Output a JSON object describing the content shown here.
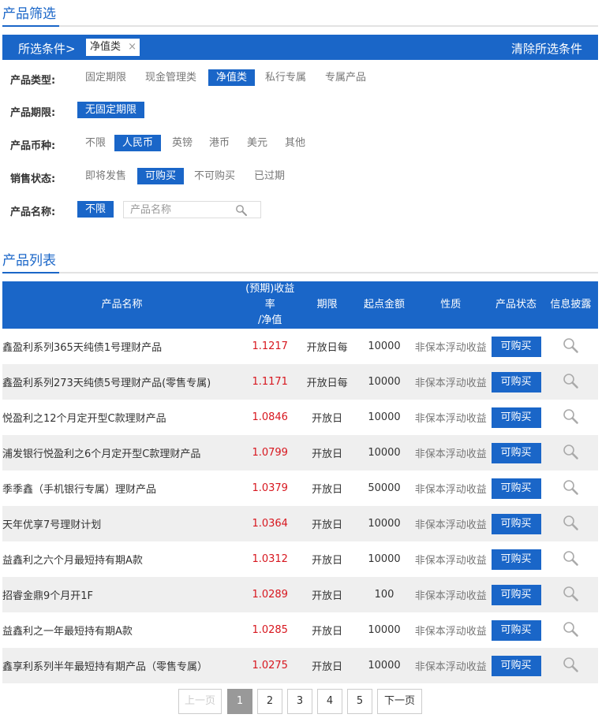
{
  "filter_section": {
    "title": "产品筛选",
    "bar_label": "所选条件>",
    "chip_label": "净值类",
    "chip_close": "×",
    "clear_label": "清除所选条件"
  },
  "filters": {
    "type": {
      "label": "产品类型:",
      "options": [
        "固定期限",
        "现金管理类",
        "净值类",
        "私行专属",
        "专属产品"
      ],
      "selected": "净值类"
    },
    "term": {
      "label": "产品期限:",
      "options": [
        "无固定期限"
      ],
      "selected": "无固定期限"
    },
    "currency": {
      "label": "产品币种:",
      "options": [
        "不限",
        "人民币",
        "英镑",
        "港币",
        "美元",
        "其他"
      ],
      "selected": "人民币"
    },
    "sale_status": {
      "label": "销售状态:",
      "options": [
        "即将发售",
        "可购买",
        "不可购买",
        "已过期"
      ],
      "selected": "可购买"
    },
    "name": {
      "label": "产品名称:",
      "options": [
        "不限"
      ],
      "selected": "不限",
      "placeholder": "产品名称"
    }
  },
  "list_section": {
    "title": "产品列表"
  },
  "table": {
    "headers": {
      "name": "产品名称",
      "rate_line1": "(预期)收益率",
      "rate_line2": "/净值",
      "term": "期限",
      "min_amount": "起点金额",
      "nature": "性质",
      "status": "产品状态",
      "disclosure": "信息披露"
    },
    "rows": [
      {
        "name": "鑫盈利系列365天纯债1号理财产品",
        "rate": "1.1217",
        "term": "开放日每",
        "min": "10000",
        "nature": "非保本浮动收益",
        "status": "可购买"
      },
      {
        "name": "鑫盈利系列273天纯债5号理财产品(零售专属)",
        "rate": "1.1171",
        "term": "开放日每",
        "min": "10000",
        "nature": "非保本浮动收益",
        "status": "可购买"
      },
      {
        "name": "悦盈利之12个月定开型C款理财产品",
        "rate": "1.0846",
        "term": "开放日",
        "min": "10000",
        "nature": "非保本浮动收益",
        "status": "可购买"
      },
      {
        "name": "浦发银行悦盈利之6个月定开型C款理财产品",
        "rate": "1.0799",
        "term": "开放日",
        "min": "10000",
        "nature": "非保本浮动收益",
        "status": "可购买"
      },
      {
        "name": "季季鑫（手机银行专属）理财产品",
        "rate": "1.0379",
        "term": "开放日",
        "min": "50000",
        "nature": "非保本浮动收益",
        "status": "可购买"
      },
      {
        "name": "天年优享7号理财计划",
        "rate": "1.0364",
        "term": "开放日",
        "min": "10000",
        "nature": "非保本浮动收益",
        "status": "可购买"
      },
      {
        "name": "益鑫利之六个月最短持有期A款",
        "rate": "1.0312",
        "term": "开放日",
        "min": "10000",
        "nature": "非保本浮动收益",
        "status": "可购买"
      },
      {
        "name": "招睿金鼎9个月开1F",
        "rate": "1.0289",
        "term": "开放日",
        "min": "100",
        "nature": "非保本浮动收益",
        "status": "可购买"
      },
      {
        "name": "益鑫利之一年最短持有期A款",
        "rate": "1.0285",
        "term": "开放日",
        "min": "10000",
        "nature": "非保本浮动收益",
        "status": "可购买"
      },
      {
        "name": "鑫享利系列半年最短持有期产品（零售专属）",
        "rate": "1.0275",
        "term": "开放日",
        "min": "10000",
        "nature": "非保本浮动收益",
        "status": "可购买"
      }
    ]
  },
  "pagination": {
    "prev": "上一页",
    "pages": [
      "1",
      "2",
      "3",
      "4",
      "5"
    ],
    "current": "1",
    "next": "下一页"
  },
  "colors": {
    "accent": "#1a66c8",
    "rate": "#d7161e"
  },
  "icons": {
    "search": "magnifier-icon",
    "disclosure": "magnifier-icon",
    "chip_close": "close-icon"
  }
}
